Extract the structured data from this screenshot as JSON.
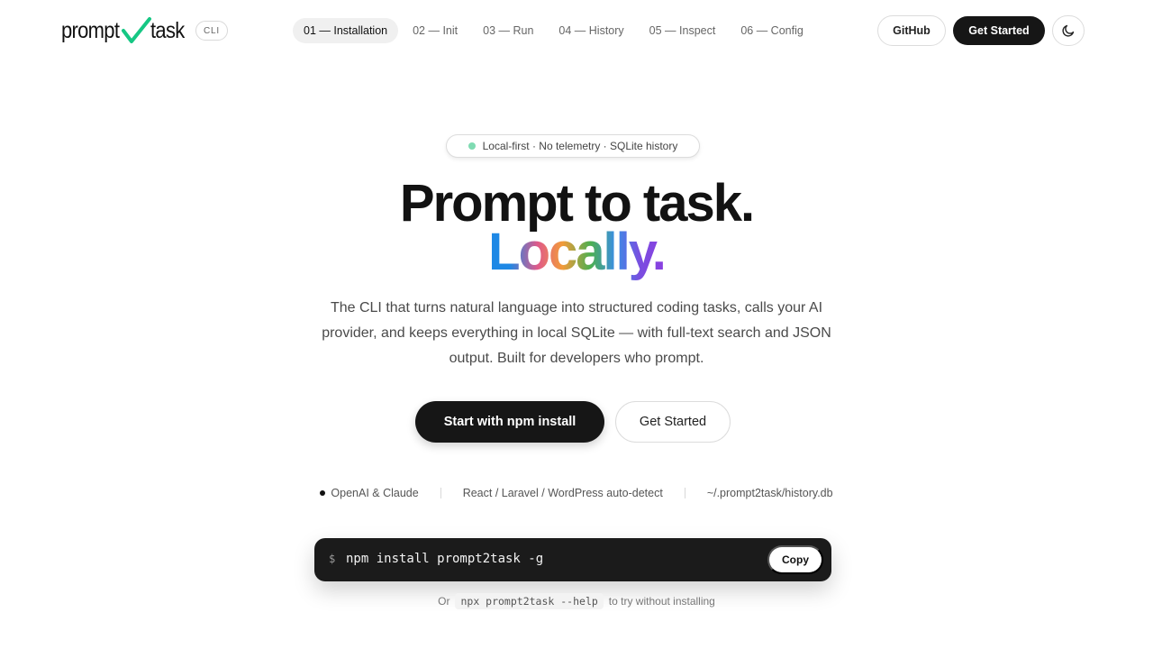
{
  "header": {
    "logo": {
      "text_left": "prompt",
      "text_right": "task",
      "check_color": "#16c784"
    },
    "badge": "CLI",
    "nav": [
      {
        "label": "01 — Installation",
        "active": true
      },
      {
        "label": "02 — Init",
        "active": false
      },
      {
        "label": "03 — Run",
        "active": false
      },
      {
        "label": "04 — History",
        "active": false
      },
      {
        "label": "05 — Inspect",
        "active": false
      },
      {
        "label": "06 — Config",
        "active": false
      }
    ],
    "github_label": "GitHub",
    "get_started_label": "Get Started",
    "theme_icon": "moon-icon"
  },
  "hero": {
    "pill": "Local-first · No telemetry · SQLite history",
    "title_line1": "Prompt to task.",
    "title_line2": "Locally.",
    "description": "The CLI that turns natural language into structured coding tasks, calls your AI provider, and keeps everything in local SQLite — with full-text search and JSON output. Built for developers who prompt.",
    "primary_button": "Start with npm install",
    "secondary_button": "Get Started"
  },
  "features": [
    "OpenAI & Claude",
    "React / Laravel / WordPress auto-detect",
    "~/.prompt2task/history.db"
  ],
  "terminal": {
    "prompt": "$",
    "command": "npm install prompt2task -g",
    "copy_label": "Copy"
  },
  "hint": {
    "prefix": "Or",
    "code": "npx prompt2task --help",
    "suffix": "to try without installing"
  },
  "colors": {
    "primary_dark": "#161616",
    "pill_dot": "#7fdbb2",
    "accent_check": "#16c784"
  }
}
